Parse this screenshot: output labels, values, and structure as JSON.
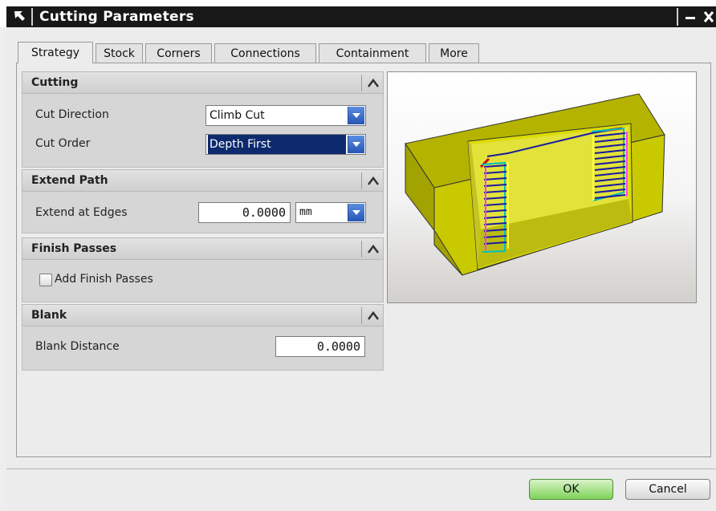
{
  "window": {
    "title": "Cutting Parameters"
  },
  "tabs": [
    {
      "label": "Strategy",
      "active": true
    },
    {
      "label": "Stock"
    },
    {
      "label": "Corners"
    },
    {
      "label": "Connections"
    },
    {
      "label": "Containment"
    },
    {
      "label": "More"
    }
  ],
  "groups": {
    "cutting": {
      "title": "Cutting",
      "cut_direction_label": "Cut Direction",
      "cut_direction_value": "Climb Cut",
      "cut_order_label": "Cut Order",
      "cut_order_value": "Depth First"
    },
    "extend_path": {
      "title": "Extend Path",
      "extend_at_edges_label": "Extend at Edges",
      "extend_at_edges_value": "0.0000",
      "unit_value": "mm"
    },
    "finish_passes": {
      "title": "Finish Passes",
      "add_finish_passes_label": "Add Finish Passes",
      "add_finish_passes_checked": false
    },
    "blank": {
      "title": "Blank",
      "blank_distance_label": "Blank Distance",
      "blank_distance_value": "0.0000"
    }
  },
  "preview": {
    "icon": "pocket-toolpath-preview",
    "part_color": "#c8c800"
  },
  "buttons": {
    "ok_label": "OK",
    "cancel_label": "Cancel"
  },
  "colors": {
    "titlebar": "#181818",
    "selection": "#0d2a6e",
    "ok_button": "#7ed35a",
    "dropdown": "#2f66c8"
  }
}
